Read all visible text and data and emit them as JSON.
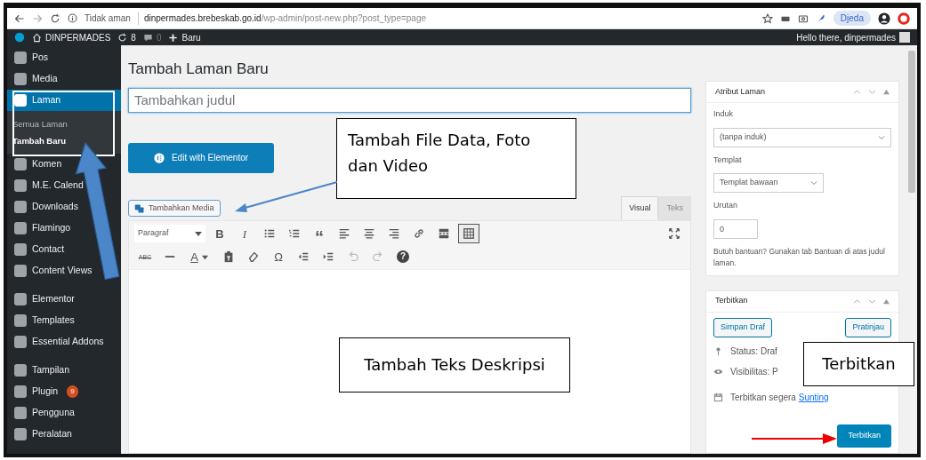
{
  "browser": {
    "security": "Tidak aman",
    "url_domain": "dinpermades.brebeskab.go.id",
    "url_path": "/wp-admin/post-new.php?post_type=page",
    "profile": "Djeda"
  },
  "admin_bar": {
    "site": "DINPERMADES",
    "updates": "8",
    "comments": "0",
    "new": "Baru",
    "greeting": "Hello there, dinpermades"
  },
  "sidebar": {
    "items": [
      {
        "kind": "menu",
        "label": "Pos",
        "selected": false
      },
      {
        "kind": "menu",
        "label": "Media",
        "selected": false
      },
      {
        "kind": "menu",
        "label": "Laman",
        "selected": true,
        "children": [
          {
            "label": "Semua Laman",
            "selected": false
          },
          {
            "label": "Tambah Baru",
            "selected": true
          }
        ]
      },
      {
        "kind": "menu",
        "label": "Komen",
        "selected": false
      },
      {
        "kind": "menu",
        "label": "M.E. Calend",
        "selected": false
      },
      {
        "kind": "menu",
        "label": "Downloads",
        "selected": false
      },
      {
        "kind": "menu",
        "label": "Flamingo",
        "selected": false
      },
      {
        "kind": "menu",
        "label": "Contact",
        "selected": false
      },
      {
        "kind": "menu",
        "label": "Content Views",
        "selected": false
      },
      {
        "kind": "separator"
      },
      {
        "kind": "menu",
        "label": "Elementor",
        "selected": false
      },
      {
        "kind": "menu",
        "label": "Templates",
        "selected": false
      },
      {
        "kind": "menu",
        "label": "Essential Addons",
        "selected": false
      },
      {
        "kind": "separator"
      },
      {
        "kind": "menu",
        "label": "Tampilan",
        "selected": false
      },
      {
        "kind": "menu",
        "label": "Plugin",
        "selected": false,
        "badge": "9"
      },
      {
        "kind": "menu",
        "label": "Pengguna",
        "selected": false
      },
      {
        "kind": "menu",
        "label": "Peralatan",
        "selected": false
      }
    ]
  },
  "page": {
    "heading": "Tambah Laman Baru",
    "title_field": {
      "placeholder": "Tambahkan judul"
    },
    "elementor_button": "Edit with Elementor",
    "add_media_button": "Tambahkan Media"
  },
  "editor": {
    "tabs": [
      {
        "label": "Visual",
        "selected": true
      },
      {
        "label": "Teks",
        "selected": false
      }
    ],
    "format_select": "Paragraf",
    "toolbar_row1": [
      {
        "kind": "bold",
        "glyph": "B",
        "pressed": false
      },
      {
        "kind": "italic",
        "glyph": "I",
        "pressed": false
      },
      {
        "kind": "bullet-list",
        "pressed": false
      },
      {
        "kind": "number-list",
        "pressed": false
      },
      {
        "kind": "quote",
        "glyph": "“",
        "pressed": false
      },
      {
        "kind": "align-left",
        "pressed": false
      },
      {
        "kind": "align-center",
        "pressed": false
      },
      {
        "kind": "align-right",
        "pressed": false
      },
      {
        "kind": "link",
        "pressed": false
      },
      {
        "kind": "read-more",
        "pressed": false
      },
      {
        "kind": "toolbar-toggle",
        "pressed": true
      }
    ],
    "toolbar_row2": [
      {
        "kind": "strikethrough",
        "glyph": "ABC",
        "disabled": false
      },
      {
        "kind": "hr",
        "disabled": false
      },
      {
        "kind": "text-color",
        "glyph": "A",
        "disabled": false
      },
      {
        "kind": "paste-text",
        "disabled": false
      },
      {
        "kind": "clear-format",
        "disabled": false
      },
      {
        "kind": "special-char",
        "glyph": "Ω",
        "disabled": false
      },
      {
        "kind": "outdent",
        "disabled": false
      },
      {
        "kind": "indent",
        "disabled": false
      },
      {
        "kind": "undo",
        "disabled": true
      },
      {
        "kind": "redo",
        "disabled": true
      },
      {
        "kind": "help",
        "glyph": "?",
        "disabled": false
      }
    ]
  },
  "attributes_box": {
    "title": "Atribut Laman",
    "parent_label": "Induk",
    "parent_value": "(tanpa induk)",
    "template_label": "Templat",
    "template_value": "Templat bawaan",
    "order_label": "Urutan",
    "order_value": "0",
    "help": "Butuh bantuan? Gunakan tab Bantuan di atas judul laman."
  },
  "publish_box": {
    "title": "Terbitkan",
    "save_draft": "Simpan Draf",
    "preview": "Pratinjau",
    "status": "Status: Draf",
    "visibility": "Visibilitas: P",
    "schedule": "Terbitkan segera",
    "schedule_link": "Sunting",
    "publish_button": "Terbitkan"
  },
  "annotations": [
    {
      "kind": "callout",
      "text": "Tambah File Data, Foto dan Video"
    },
    {
      "kind": "callout",
      "text": "Tambah Teks Deskripsi"
    },
    {
      "kind": "callout",
      "text": "Terbitkan"
    }
  ]
}
